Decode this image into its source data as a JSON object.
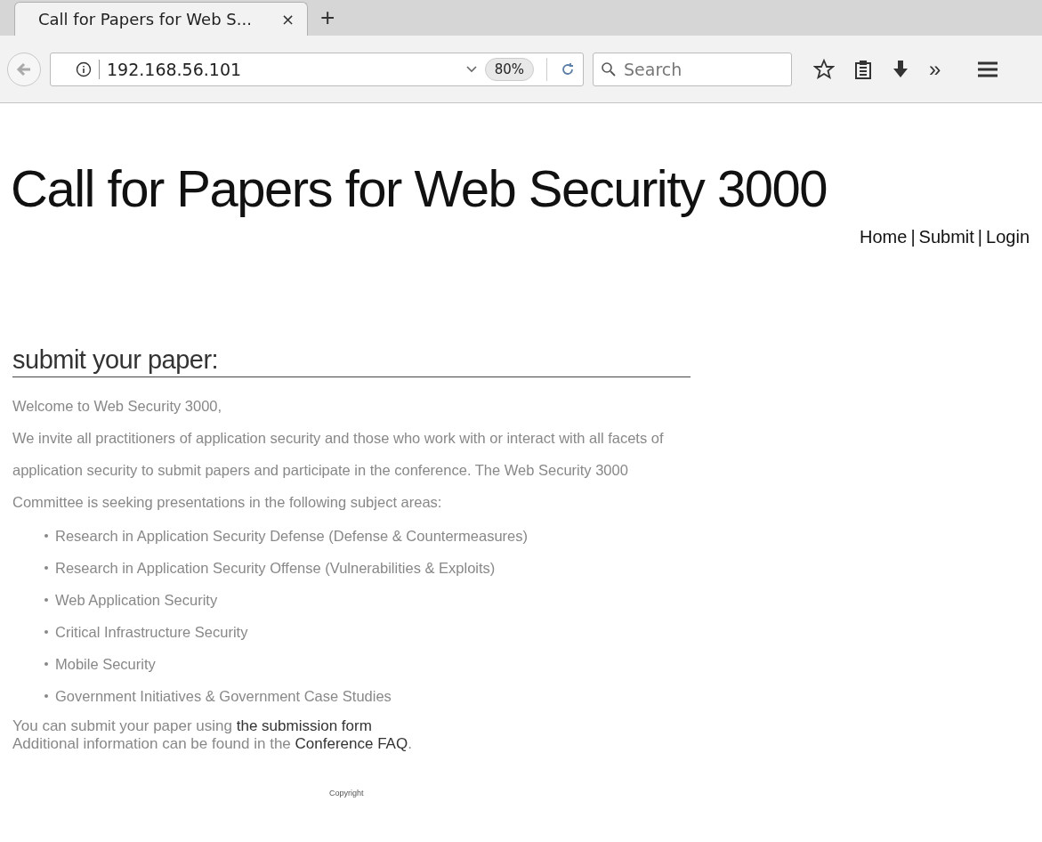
{
  "browser": {
    "tab": {
      "title": "Call for Papers for Web S...",
      "close": "×"
    },
    "new_tab": "+",
    "url": "192.168.56.101",
    "zoom": "80%",
    "search": {
      "placeholder": "Search"
    },
    "overflow": "»"
  },
  "page": {
    "title": "Call for Papers for Web Security 3000",
    "nav": [
      {
        "label": "Home"
      },
      {
        "label": "Submit"
      },
      {
        "label": "Login"
      }
    ],
    "nav_separator": "|",
    "section_heading": "submit your paper:",
    "greeting": "Welcome to Web Security 3000,",
    "intro": "We invite all practitioners of application security and those who work with or interact with all facets of application security to submit papers and participate in the conference. The Web Security 3000 Committee is seeking presentations in the following subject areas:",
    "topics": [
      "Research in Application Security Defense (Defense & Countermeasures)",
      "Research in Application Security Offense (Vulnerabilities & Exploits)",
      "Web Application Security",
      "Critical Infrastructure Security",
      "Mobile Security",
      "Government Initiatives & Government Case Studies"
    ],
    "links": [
      {
        "before": "You can submit your paper using ",
        "link": "the submission form"
      },
      {
        "before": "Additional information can be found in the ",
        "link": "Conference FAQ",
        "after": "."
      }
    ],
    "footer": "Copyright"
  }
}
